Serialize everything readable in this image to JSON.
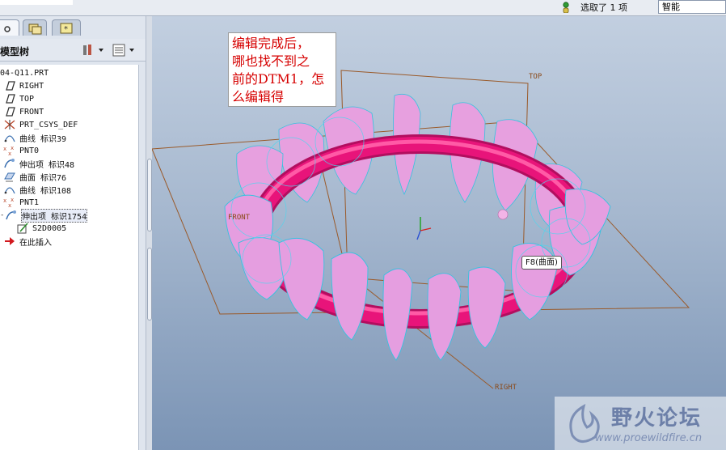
{
  "topbar": {
    "status": "选取了 1 项",
    "filter_value": "智能"
  },
  "left_panel": {
    "tree_title": "模型树",
    "tree_items": [
      {
        "label": "04-Q11.PRT",
        "icon": "part-icon"
      },
      {
        "label": "RIGHT",
        "icon": "datum-plane-icon"
      },
      {
        "label": "TOP",
        "icon": "datum-plane-icon"
      },
      {
        "label": "FRONT",
        "icon": "datum-plane-icon"
      },
      {
        "label": "PRT_CSYS_DEF",
        "icon": "coordinate-system-icon"
      },
      {
        "label": "曲线 标识39",
        "icon": "curve-icon"
      },
      {
        "label": "PNT0",
        "icon": "datum-point-icon"
      },
      {
        "label": "伸出项 标识48",
        "icon": "protrusion-icon"
      },
      {
        "label": "曲面 标识76",
        "icon": "surface-icon"
      },
      {
        "label": "曲线 标识108",
        "icon": "curve-icon"
      },
      {
        "label": "PNT1",
        "icon": "datum-point-icon"
      },
      {
        "label": "伸出项 标识1754",
        "icon": "protrusion-icon"
      },
      {
        "label": "S2D0005",
        "icon": "sketch-icon"
      },
      {
        "label": "在此插入",
        "icon": "insert-arrow-icon"
      }
    ]
  },
  "viewport": {
    "note": "编辑完成后，\n哪也找不到之\n前的DTM1，怎\n么编辑得",
    "tooltip": "F8(曲面)",
    "plane_labels": {
      "top": "TOP",
      "front": "FRONT",
      "right": "RIGHT"
    },
    "watermark_title": "野火论坛",
    "watermark_url": "www.proewildfire.cn"
  },
  "colors": {
    "torus": "#e8147a",
    "petal": "#e7a0df",
    "datum": "#9a5a2a",
    "edge_highlight": "#3fd0e8"
  }
}
